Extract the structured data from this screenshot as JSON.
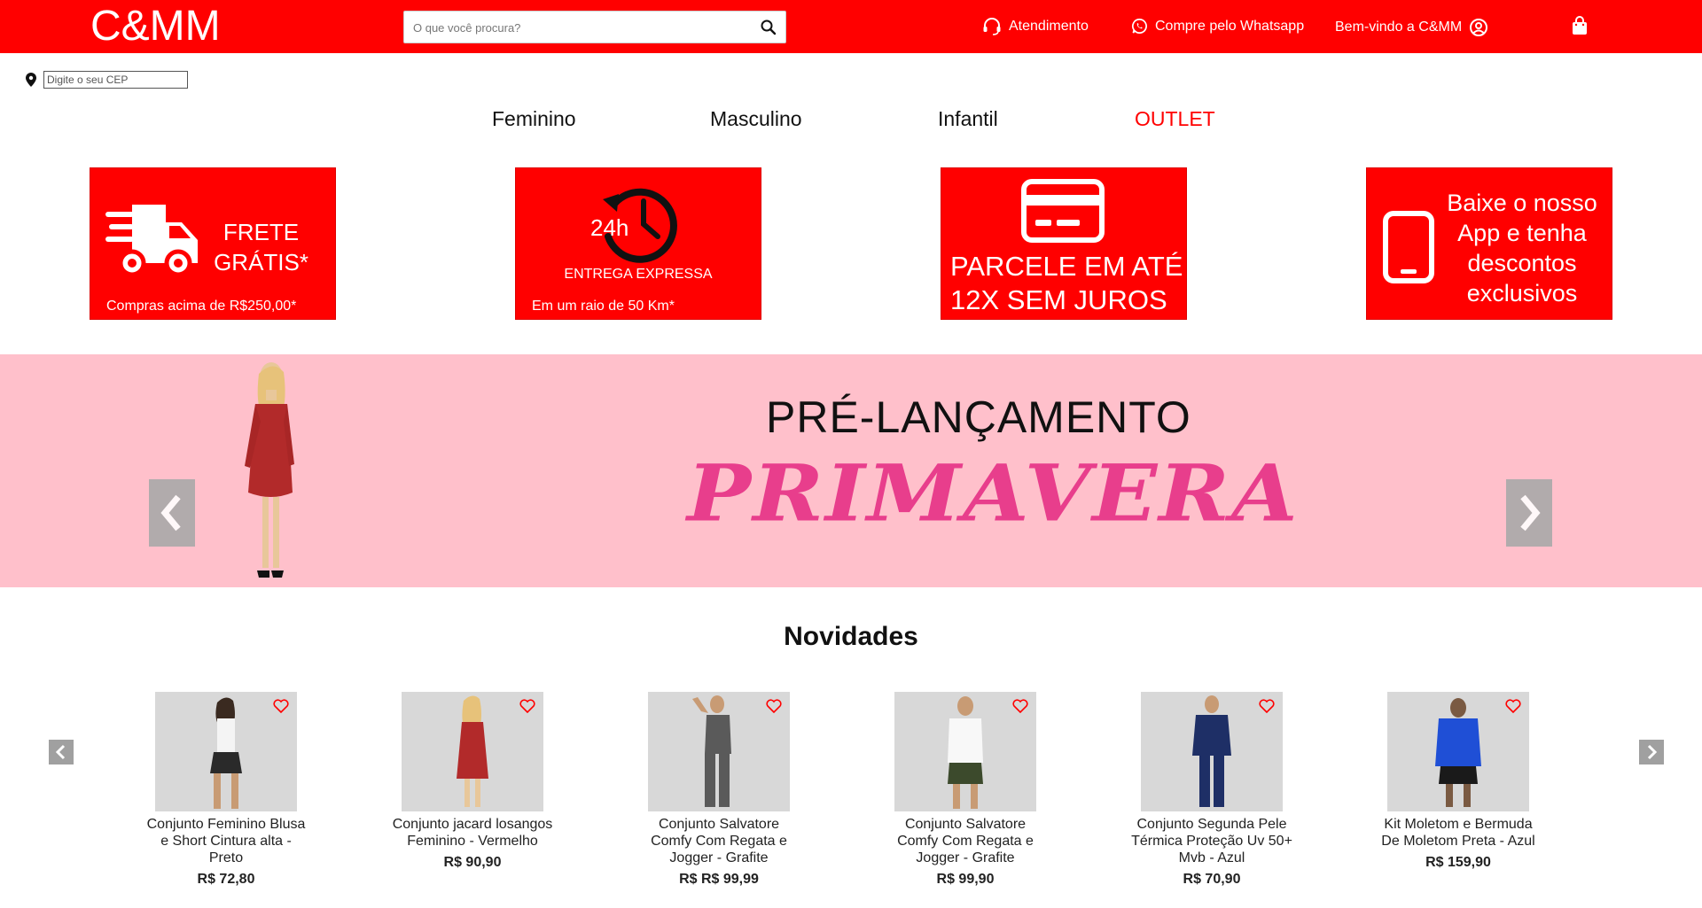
{
  "header": {
    "logo": "C&MM",
    "search_placeholder": "O que você procura?",
    "atendimento": "Atendimento",
    "whatsapp": "Compre pelo Whatsapp",
    "welcome": "Bem-vindo a C&MM"
  },
  "cep": {
    "placeholder": "Digite o seu CEP"
  },
  "nav": [
    {
      "label": "Feminino"
    },
    {
      "label": "Masculino"
    },
    {
      "label": "Infantil"
    },
    {
      "label": "OUTLET"
    }
  ],
  "features": {
    "frete": {
      "line1": "FRETE",
      "line2": "GRÁTIS*",
      "note": "Compras acima de R$250,00*"
    },
    "entrega": {
      "hours": "24h",
      "title": "ENTREGA EXPRESSA",
      "note": "Em um raio de 50 Km*"
    },
    "parcele": {
      "line1": "PARCELE EM ATÉ",
      "line2": "12X SEM JUROS"
    },
    "app": {
      "line1": "Baixe o nosso",
      "line2": "App e tenha",
      "line3": "descontos",
      "line4": "exclusivos"
    }
  },
  "banner": {
    "title": "PRÉ-LANÇAMENTO",
    "subtitle": "PRIMAVERA"
  },
  "novidades": {
    "title": "Novidades",
    "products": [
      {
        "name": "Conjunto Feminino Blusa e Short Cintura alta - Preto",
        "price": "R$ 72,80"
      },
      {
        "name": "Conjunto jacard losangos Feminino - Vermelho",
        "price": "R$ 90,90"
      },
      {
        "name": "Conjunto Salvatore Comfy Com Regata e Jogger - Grafite",
        "price": "R$ R$ 99,99"
      },
      {
        "name": "Conjunto Salvatore Comfy Com Regata e Jogger - Grafite",
        "price": "R$ 99,90"
      },
      {
        "name": "Conjunto Segunda Pele Térmica Proteção Uv 50+ Mvb - Azul",
        "price": "R$ 70,90"
      },
      {
        "name": "Kit Moletom e Bermuda De Moletom Preta - Azul",
        "price": "R$ 159,90"
      }
    ]
  },
  "colors": {
    "brand": "#ff0000",
    "banner_bg": "#ffc0cb",
    "accent_pink": "#e83e8c"
  },
  "icons": [
    "search-icon",
    "headset-icon",
    "whatsapp-icon",
    "user-circle-icon",
    "shopping-bag-icon",
    "location-pin-icon",
    "truck-icon",
    "clock-history-icon",
    "credit-card-icon",
    "smartphone-icon",
    "chevron-left-icon",
    "chevron-right-icon",
    "heart-icon"
  ]
}
